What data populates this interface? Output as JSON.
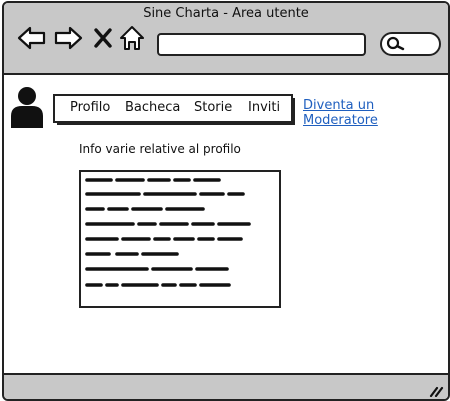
{
  "window": {
    "title": "Sine Charta - Area utente"
  },
  "toolbar": {
    "icons": [
      "back-arrow-icon",
      "forward-arrow-icon",
      "close-x-icon",
      "home-icon"
    ],
    "url_value": "",
    "search_value": ""
  },
  "menu": {
    "items": [
      {
        "label": "Profilo"
      },
      {
        "label": "Bacheca"
      },
      {
        "label": "Storie"
      },
      {
        "label": "Inviti"
      }
    ]
  },
  "moderator_link": "Diventa un Moderatore",
  "profile": {
    "info_label": "Info varie relative al profilo",
    "text_placeholder_lines": 8
  },
  "colors": {
    "chrome": "#c8c8c8",
    "link": "#1f5fbf",
    "ink": "#111111"
  }
}
